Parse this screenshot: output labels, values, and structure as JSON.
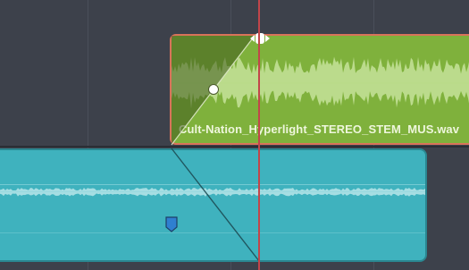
{
  "timeline": {
    "clips": {
      "music": {
        "name": "Cult-Nation_Hyperlight_STEREO_STEM_MUS.wav",
        "color": "#7fb13c",
        "selected_border_color": "#d8735a"
      },
      "dialogue": {
        "color": "#3fb2be"
      }
    },
    "playhead_color": "#c2454a",
    "icons": {
      "fade_handle": "fade-handle-icon",
      "fade_point": "fade-curve-point-icon",
      "keyframe": "keyframe-marker-icon"
    }
  }
}
